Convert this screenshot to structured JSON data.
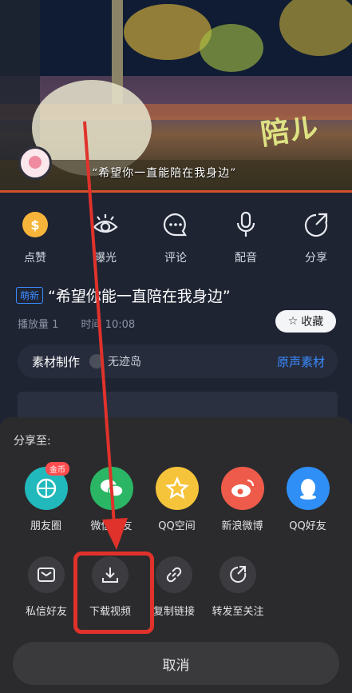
{
  "video": {
    "caption": "“希望你一直能陪在我身边”",
    "watermark": "陪ル"
  },
  "actions": [
    {
      "label": "点赞",
      "icon": "coin-icon"
    },
    {
      "label": "曝光",
      "icon": "eye-icon"
    },
    {
      "label": "评论",
      "icon": "comment-icon"
    },
    {
      "label": "配音",
      "icon": "microphone-icon"
    },
    {
      "label": "分享",
      "icon": "share-icon"
    }
  ],
  "post": {
    "tag": "萌新",
    "title": "“希望你能一直陪在我身边”",
    "plays": "播放量 1",
    "time": "时间 10:08",
    "collect_label": "收藏"
  },
  "material": {
    "left_label": "素材制作",
    "user": "无迹岛",
    "right_label": "原声素材"
  },
  "share_sheet": {
    "title": "分享至:",
    "targets": [
      {
        "label": "朋友圈",
        "color": "#21b9bb",
        "icon": "moments-icon",
        "badge": "金币"
      },
      {
        "label": "微信好友",
        "color": "#2ab664",
        "icon": "wechat-icon"
      },
      {
        "label": "QQ空间",
        "color": "#f6c43b",
        "icon": "qzone-icon"
      },
      {
        "label": "新浪微博",
        "color": "#ee5b4a",
        "icon": "weibo-icon"
      },
      {
        "label": "QQ好友",
        "color": "#2f8ff6",
        "icon": "qq-icon"
      }
    ],
    "tools": [
      {
        "label": "私信好友",
        "icon": "message-icon"
      },
      {
        "label": "下载视频",
        "icon": "download-icon"
      },
      {
        "label": "复制链接",
        "icon": "link-icon"
      },
      {
        "label": "转发至关注",
        "icon": "forward-icon"
      }
    ],
    "cancel_label": "取消"
  },
  "colors": {
    "accent_blue": "#3b8cff",
    "highlight_red": "#e0322b"
  }
}
